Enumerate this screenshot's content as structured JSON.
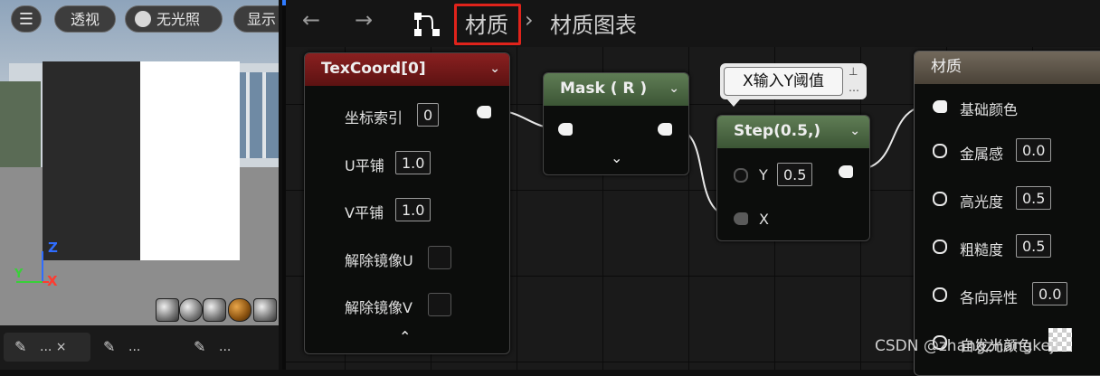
{
  "viewport": {
    "buttons": {
      "menu": "☰",
      "perspective": "透视",
      "lit": "无光照",
      "show": "显示"
    },
    "axes": {
      "z": "Z",
      "x": "X",
      "y": "Y"
    }
  },
  "tabs": [
    {
      "label": "... ×"
    },
    {
      "label": "..."
    },
    {
      "label": "..."
    }
  ],
  "toolbar": {
    "back_icon": "←",
    "forward_icon": "→",
    "crumb_material": "材质",
    "crumb_separator": "›",
    "crumb_graph": "材质图表"
  },
  "nodes": {
    "texcoord": {
      "title": "TexCoord[0]",
      "coordinate_index_label": "坐标索引",
      "coordinate_index": "0",
      "u_tiling_label": "U平铺",
      "u_tiling": "1.0",
      "v_tiling_label": "V平铺",
      "v_tiling": "1.0",
      "unmirror_u_label": "解除镜像U",
      "unmirror_v_label": "解除镜像V",
      "collapse": "⌃"
    },
    "mask": {
      "title": "Mask ( R )",
      "expand": "⌄"
    },
    "step": {
      "title": "Step(0.5,)",
      "comment": "X输入Y阈值",
      "y_label": "Y",
      "y_value": "0.5",
      "x_label": "X"
    },
    "material": {
      "title": "材质",
      "pins": [
        {
          "label": "基础颜色"
        },
        {
          "label": "金属感",
          "value": "0.0"
        },
        {
          "label": "高光度",
          "value": "0.5"
        },
        {
          "label": "粗糙度",
          "value": "0.5"
        },
        {
          "label": "各向异性",
          "value": "0.0"
        },
        {
          "label": "自发光颜色"
        }
      ]
    }
  },
  "watermark": "CSDN @zhangzhangkeji",
  "colors": {
    "texcoord_header": "#7a1a1a",
    "mask_header": "#4e6b45",
    "step_header": "#4e6b45",
    "material_header": "#5f5548",
    "highlight_box": "#e0231b"
  }
}
